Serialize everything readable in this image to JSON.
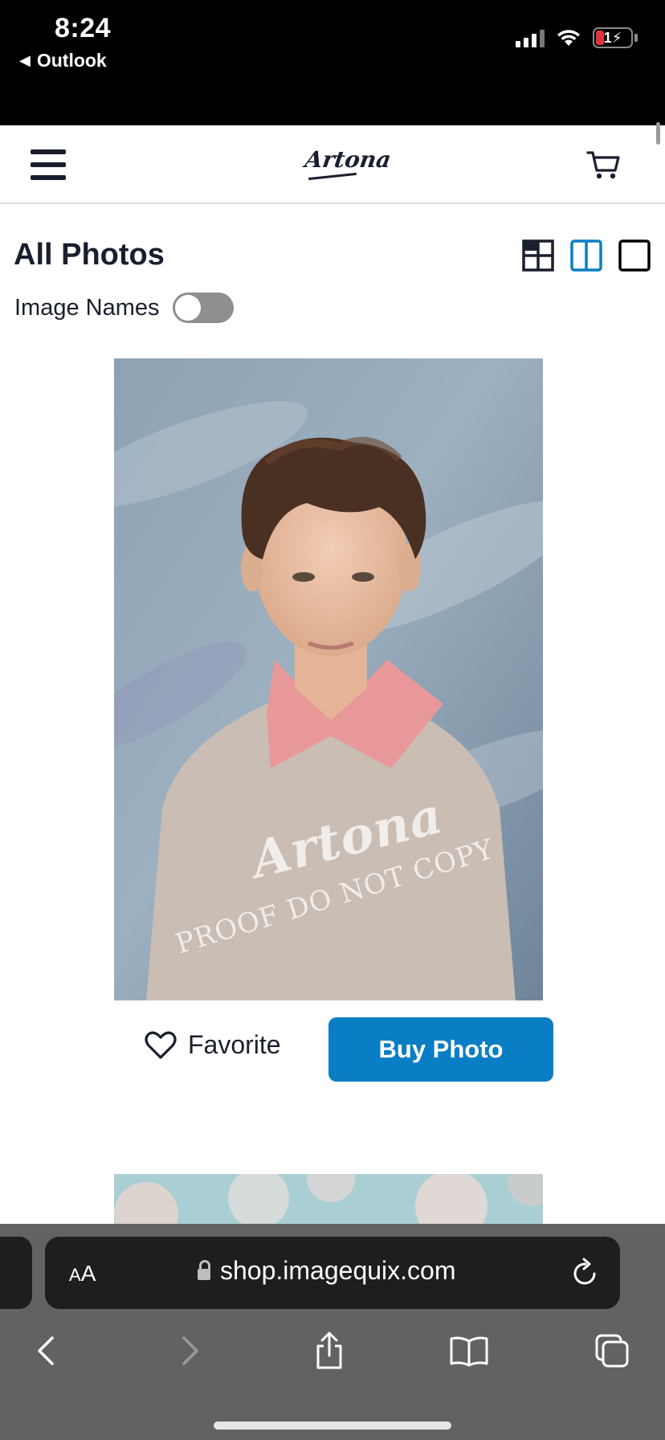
{
  "status_bar": {
    "time": "8:24",
    "back_app": "Outlook",
    "battery_level": "1"
  },
  "header": {
    "logo_text": "Artona",
    "menu_icon": "hamburger-menu-icon",
    "cart_icon": "shopping-cart-icon"
  },
  "page": {
    "title": "All Photos",
    "view_modes": [
      "grid-view",
      "two-column-view",
      "single-view"
    ],
    "active_view": "two-column-view",
    "image_names_label": "Image Names",
    "image_names_on": false
  },
  "photo": {
    "watermark_brand": "Artona",
    "watermark_text": "PROOF DO NOT COPY"
  },
  "actions": {
    "favorite_label": "Favorite",
    "buy_label": "Buy Photo"
  },
  "browser": {
    "text_size_button": "AA",
    "url": "shop.imagequix.com"
  },
  "colors": {
    "accent": "#0a7ec4",
    "text_dark": "#1a1f2e",
    "toggle_off": "#8f8f8f"
  }
}
